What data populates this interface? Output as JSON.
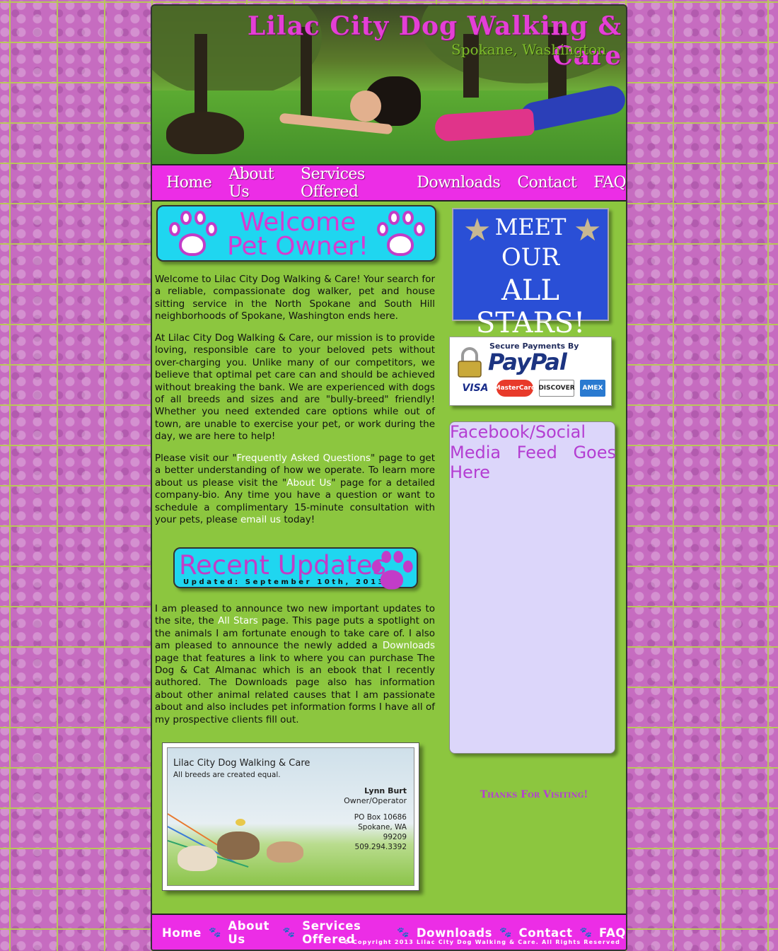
{
  "header": {
    "title": "Lilac City Dog Walking & Care",
    "subtitle": "Spokane, Washington"
  },
  "nav": [
    "Home",
    "About Us",
    "Services Offered",
    "Downloads",
    "Contact",
    "FAQ"
  ],
  "welcome": {
    "line1": "Welcome",
    "line2": "Pet Owner!"
  },
  "intro": {
    "p1": "Welcome to Lilac City Dog Walking & Care! Your search for a reliable, compassionate dog walker, pet and house sitting service in the North Spokane and South Hill neighborhoods of Spokane, Washington ends here.",
    "p2": "At Lilac City Dog Walking & Care, our mission is to provide loving, responsible care to your beloved pets without over-charging you. Unlike many of our competitors, we believe that optimal pet care can and should be achieved without breaking the bank. We are experienced with dogs of all breeds and sizes and are \"bully-breed\" friendly! Whether you need extended care options while out of town, are unable to exercise your pet, or work during the day, we are here to help!",
    "p3_a": "Please visit our \"",
    "p3_link1": "Frequently Asked Questions",
    "p3_b": "\" page to get a better understanding of how we operate. To learn more about us please visit the \"",
    "p3_link2": "About Us",
    "p3_c": "\" page for a detailed company-bio. Any time you have a question or want to schedule a complimentary 15-minute consultation with your pets, please ",
    "p3_link3": "email us",
    "p3_d": " today!"
  },
  "updates": {
    "title": "Recent Updates",
    "date": "Updated: September 10th, 2013",
    "p_a": "I am pleased to announce two new important updates to the site, the ",
    "link1": "All Stars",
    "p_b": " page. This page puts a spotlight on the animals I am fortunate enough to take care of. I also am pleased to announce the newly added a ",
    "link2": "Downloads",
    "p_c": " page that features a link to where you can purchase The Dog & Cat Almanac which is an ebook that I recently authored. The Downloads page also has information about other animal related causes that I am passionate about and also includes pet information forms I have all of my prospective clients fill out."
  },
  "card": {
    "company": "Lilac City Dog Walking & Care",
    "tagline": "All breeds are created equal.",
    "name": "Lynn Burt",
    "role": "Owner/Operator",
    "address1": "PO Box 10686",
    "address2": "Spokane, WA",
    "zip": "99209",
    "phone": "509.294.3392"
  },
  "sidebar": {
    "allstars": [
      "MEET",
      "OUR",
      "ALL STARS!"
    ],
    "paypal_secure": "Secure Payments By",
    "paypal_logo": "PayPal",
    "cards": [
      "VISA",
      "MasterCard",
      "DISCOVER",
      "AMEX"
    ],
    "social": "Facebook/Social Media Feed Goes Here",
    "thanks": "Thanks For Visiting!"
  },
  "footer": {
    "copyright": "© Copyright 2013 Lilac City Dog Walking & Care. All Rights Reserved"
  },
  "colors": {
    "page_bg": "#8cc63f",
    "nav_bg": "#ec2de6",
    "banner_bg": "#1fd6f0",
    "accent_purple": "#c23cc8",
    "allstars_bg": "#2a4fd6",
    "social_bg": "#dcd6fa"
  }
}
